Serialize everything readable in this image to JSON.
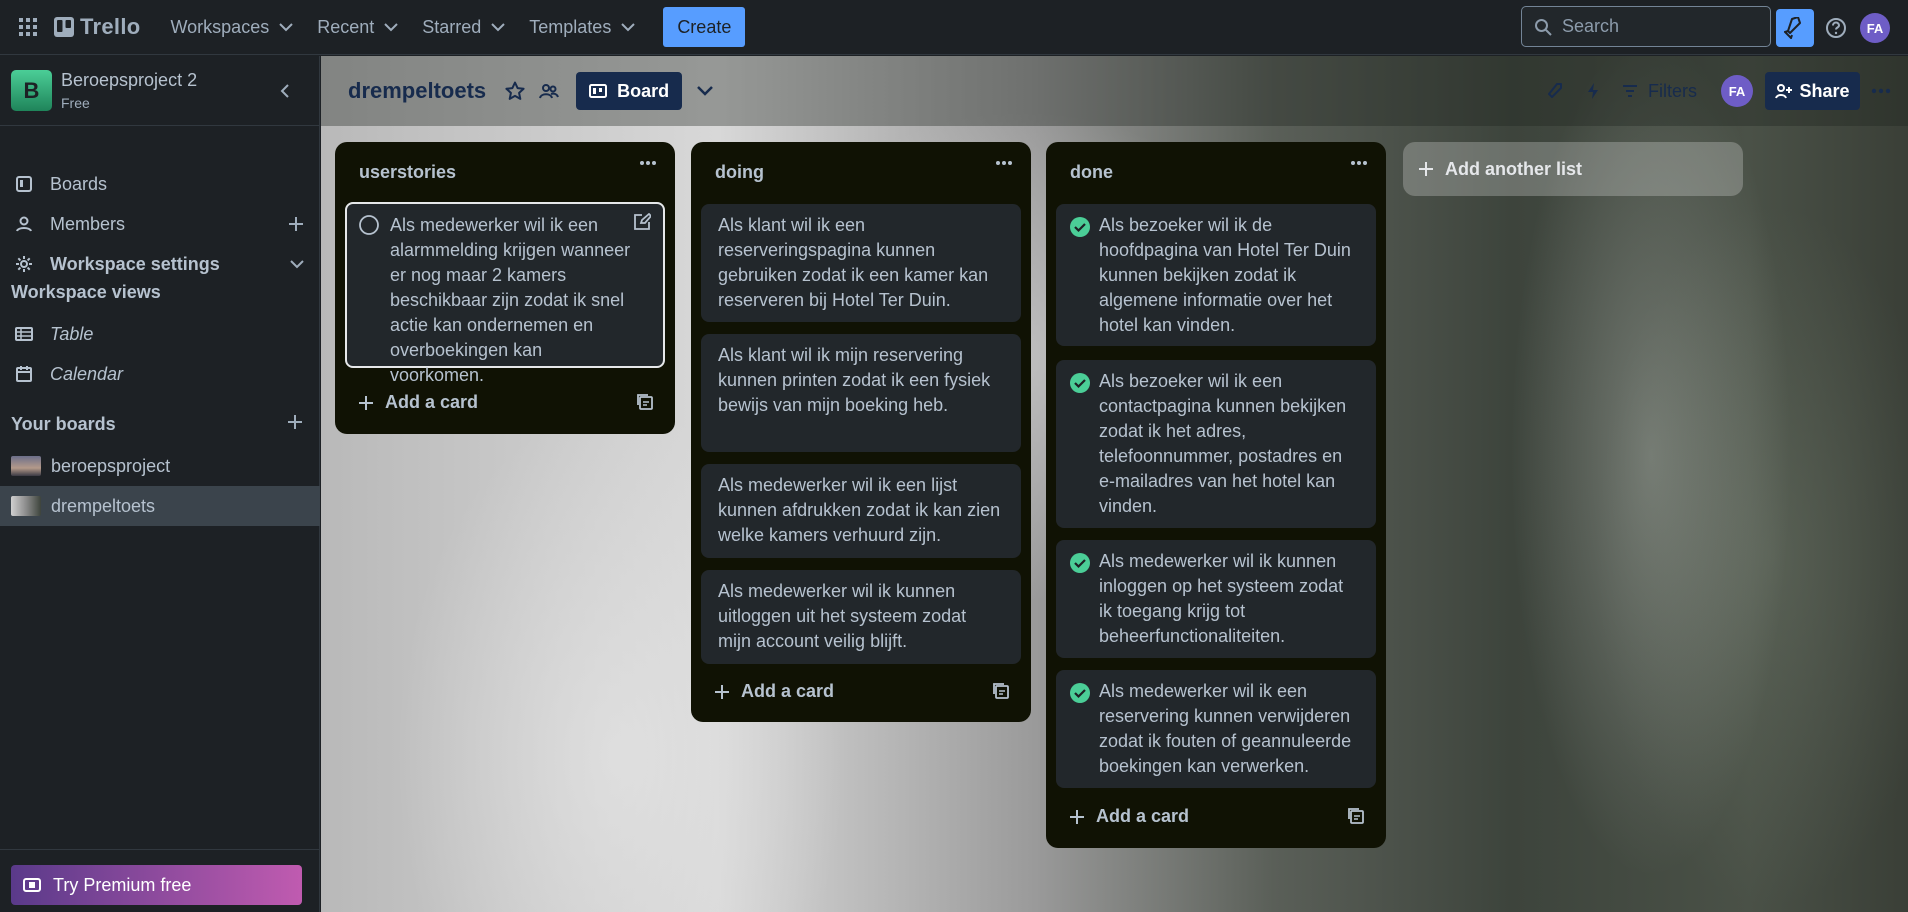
{
  "topbar": {
    "logo_text": "Trello",
    "nav": [
      "Workspaces",
      "Recent",
      "Starred",
      "Templates"
    ],
    "create_label": "Create",
    "search_placeholder": "Search",
    "avatar_initials": "FA"
  },
  "sidebar": {
    "workspace_initial": "B",
    "workspace_name": "Beroepsproject 2",
    "workspace_plan": "Free",
    "items": [
      "Boards",
      "Members",
      "Workspace settings"
    ],
    "views_heading": "Workspace views",
    "views": [
      "Table",
      "Calendar"
    ],
    "boards_heading": "Your boards",
    "boards": [
      "beroepsproject",
      "drempeltoets"
    ],
    "premium_label": "Try Premium free"
  },
  "board": {
    "title": "drempeltoets",
    "view_label": "Board",
    "filters_label": "Filters",
    "member_initials": "FA",
    "share_label": "Share",
    "add_list_label": "Add another list",
    "add_card_label": "Add a card",
    "lists": [
      {
        "title": "userstories",
        "cards": [
          "Als medewerker wil ik een alarmmelding krijgen wanneer er nog maar 2 kamers beschikbaar zijn zodat ik snel actie kan ondernemen en overboekingen kan voorkomen."
        ]
      },
      {
        "title": "doing",
        "cards": [
          "Als klant wil ik een reserveringspagina kunnen gebruiken zodat ik een kamer kan reserveren bij Hotel Ter Duin.",
          "Als klant wil ik mijn reservering kunnen printen zodat ik een fysiek bewijs van mijn boeking heb.",
          "Als medewerker wil ik een lijst kunnen afdrukken zodat ik kan zien welke kamers verhuurd zijn.",
          "Als medewerker wil ik kunnen uitloggen uit het systeem zodat mijn account veilig blijft."
        ]
      },
      {
        "title": "done",
        "cards": [
          "Als bezoeker wil ik de hoofdpagina van Hotel Ter Duin kunnen bekijken zodat ik algemene informatie over het hotel kan vinden.",
          "Als bezoeker wil ik een contactpagina kunnen bekijken zodat ik het adres, telefoonnummer, postadres en e-mailadres van het hotel kan vinden.",
          "Als medewerker wil ik kunnen inloggen op het systeem zodat ik toegang krijg tot beheerfunctionaliteiten.",
          "Als medewerker wil ik een reservering kunnen verwijderen zodat ik fouten of geannuleerde boekingen kan verwerken."
        ]
      }
    ]
  },
  "colors": {
    "accent": "#579dff",
    "done_check": "#4bce97",
    "list_bg": "#101204",
    "card_bg": "#22272b"
  }
}
